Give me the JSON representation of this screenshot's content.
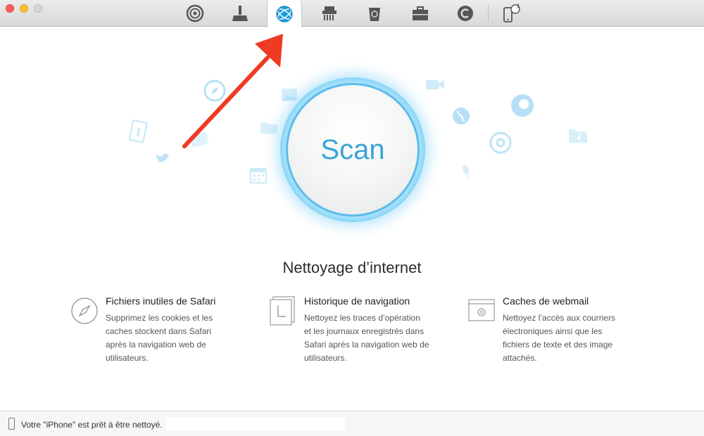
{
  "window": {
    "traffic_lights": [
      "close",
      "minimize",
      "zoom"
    ]
  },
  "toolbar": {
    "tabs": [
      {
        "icon": "podcast-icon",
        "active": false
      },
      {
        "icon": "broom-icon",
        "active": false
      },
      {
        "icon": "globe-icon",
        "active": true
      },
      {
        "icon": "shredder-icon",
        "active": false
      },
      {
        "icon": "trash-icon",
        "active": false
      },
      {
        "icon": "toolbox-icon",
        "active": false
      },
      {
        "icon": "restore-icon",
        "active": false
      },
      {
        "icon": "iphone-icon",
        "active": false,
        "badge": "1"
      }
    ]
  },
  "scan": {
    "label": "Scan"
  },
  "section": {
    "heading": "Nettoyage d’internet"
  },
  "features": [
    {
      "icon": "compass-icon",
      "title": "Fichiers inutiles de Safari",
      "lines": [
        "Supprimez les cookies et les",
        "caches stockent dans Safari",
        "après la navigation web de",
        "utilisateurs."
      ]
    },
    {
      "icon": "history-icon",
      "title": "Historique de navigation",
      "lines": [
        "Nettoyez les traces d’opération",
        "et les journaux enregistrés dans",
        "Safari après la navigation web de",
        "utilisateurs."
      ]
    },
    {
      "icon": "webmail-icon",
      "title": "Caches de webmail",
      "lines": [
        "Nettoyez l’accès aux courriers",
        "électroniques ainsi que les",
        "fichiers de texte et des image",
        "attachés."
      ]
    }
  ],
  "status": {
    "text": "Votre \"iPhone\" est prêt à être nettoyé."
  },
  "colors": {
    "accent": "#3aa3d8",
    "arrow": "#f03a23",
    "active_tab_icon": "#1e9fe0"
  }
}
